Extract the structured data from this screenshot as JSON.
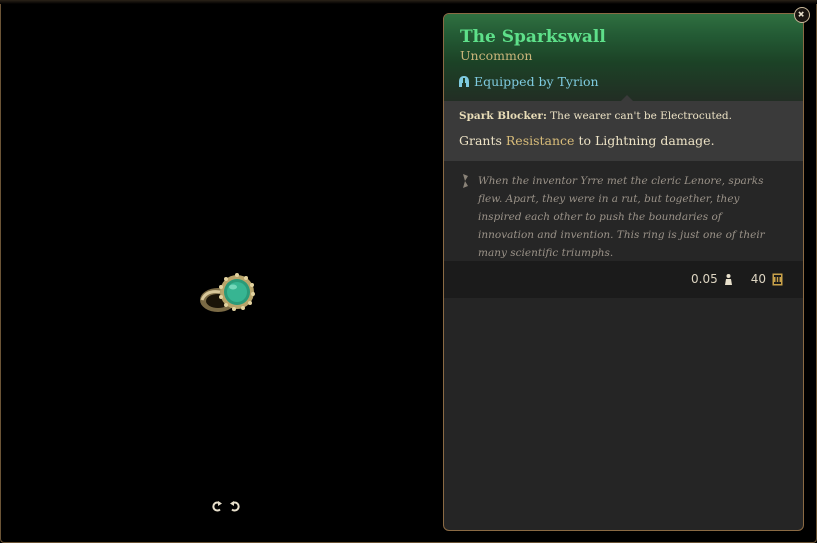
{
  "item": {
    "name": "The Sparkswall",
    "rarity": "Uncommon",
    "equipped_by": "Equipped by Tyrion",
    "passive_name": "Spark Blocker:",
    "passive_desc": "The wearer can't be Electrocuted.",
    "grants_prefix": "Grants",
    "grants_keyword": "Resistance",
    "grants_suffix": "to Lightning damage.",
    "lore": "When the inventor Yrre met the cleric Lenore, sparks flew. Apart, they were in a rut, but together, they inspired each other to push the boundaries of innovation and invention. This ring is just one of their many scientific triumphs.",
    "weight": "0.05",
    "value": "40"
  },
  "icons": {
    "equipped": "helmet-icon",
    "lore": "scroll-quill-icon",
    "weight": "weight-icon",
    "value": "gold-coin-icon",
    "rotate_left": "rotate-left-icon",
    "rotate_right": "rotate-right-icon",
    "close": "close-icon"
  },
  "colors": {
    "rarity_uncommon": "#5ee08a",
    "header_green": "#235a34",
    "equipped_blue": "#7fcbe0",
    "keyword_gold": "#d9bd7a",
    "frame_bronze": "#8a6a44"
  }
}
